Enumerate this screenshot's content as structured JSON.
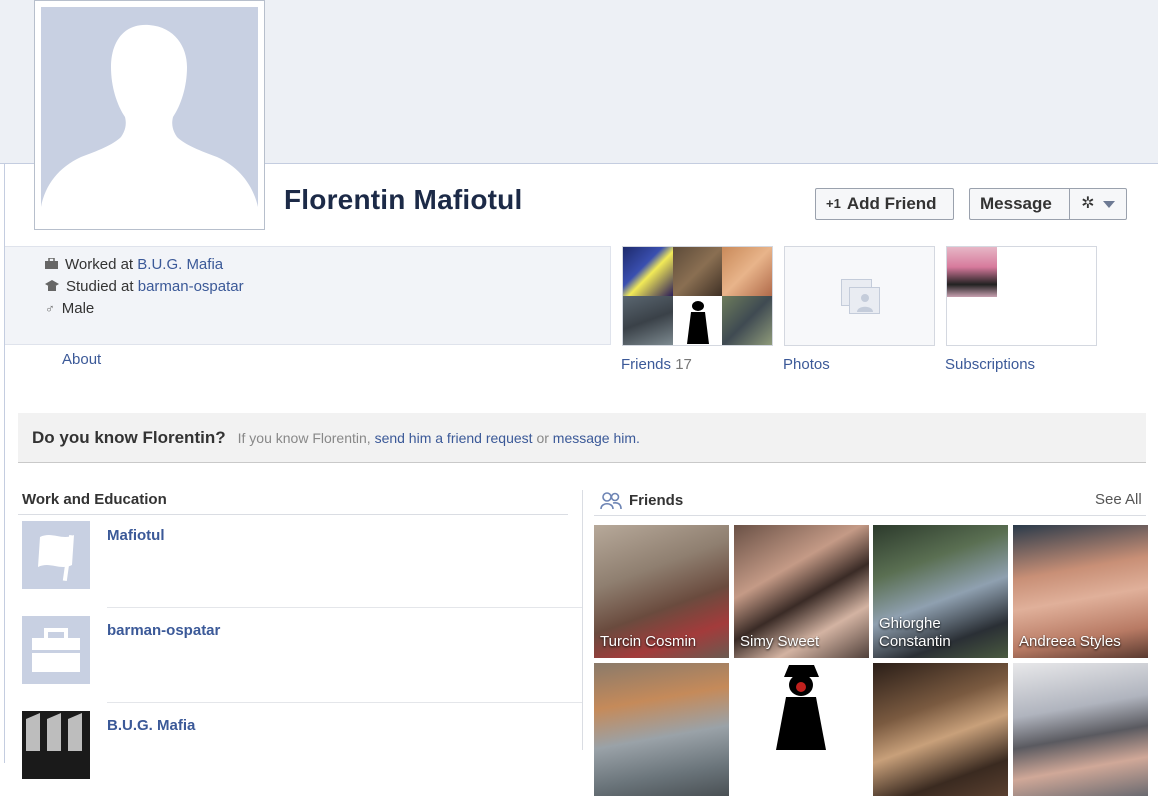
{
  "profile": {
    "name": "Florentin Mafiotul",
    "add_friend_label": "Add Friend",
    "message_label": "Message"
  },
  "info": {
    "worked_prefix": "Worked at",
    "worked_place": "B.U.G. Mafia",
    "studied_prefix": "Studied at",
    "studied_place": "barman-ospatar",
    "gender": "Male",
    "about_label": "About"
  },
  "tiles": {
    "friends_label": "Friends",
    "friends_count": "17",
    "photos_label": "Photos",
    "subscriptions_label": "Subscriptions"
  },
  "know_bar": {
    "title": "Do you know Florentin?",
    "text_prefix": "If you know Florentin,",
    "send_request": "send him a friend request",
    "or": "or",
    "message_link": "message him."
  },
  "work_education": {
    "heading": "Work and Education",
    "items": [
      {
        "title": "Mafiotul",
        "icon": "flag-icon"
      },
      {
        "title": "barman-ospatar",
        "icon": "briefcase-icon"
      },
      {
        "title": "B.U.G. Mafia",
        "icon": "bug-mafia-logo"
      }
    ]
  },
  "friends_section": {
    "heading": "Friends",
    "see_all": "See All",
    "friends": [
      {
        "name": "Turcin Cosmin"
      },
      {
        "name": "Simy Sweet"
      },
      {
        "name": "Ghiorghe Constantin"
      },
      {
        "name": "Andreea Styles"
      },
      {
        "name": ""
      },
      {
        "name": ""
      },
      {
        "name": ""
      },
      {
        "name": ""
      }
    ]
  },
  "colors": {
    "link": "#3b5998",
    "cover_bg": "#edf0f5",
    "placeholder": "#c8d0e2"
  }
}
